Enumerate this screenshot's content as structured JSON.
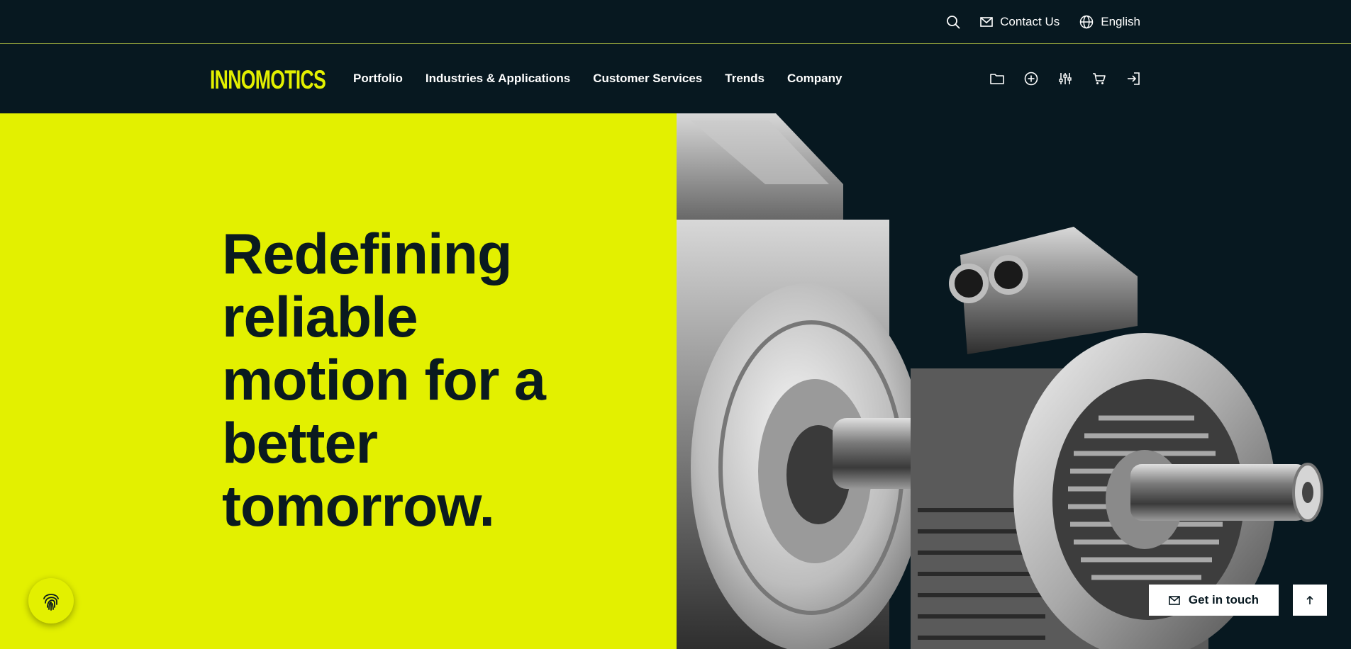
{
  "colors": {
    "brand_accent": "#e3f000",
    "background_dark": "#071820",
    "headline_text": "#0a1a1f",
    "nav_text": "#ffffff"
  },
  "utility_bar": {
    "search_icon": "search-icon",
    "contact_label": "Contact Us",
    "contact_icon": "mail-icon",
    "language_label": "English",
    "language_icon": "globe-icon"
  },
  "header": {
    "logo_text": "INNOMOTICS",
    "nav": [
      {
        "label": "Portfolio"
      },
      {
        "label": "Industries & Applications"
      },
      {
        "label": "Customer Services"
      },
      {
        "label": "Trends"
      },
      {
        "label": "Company"
      }
    ],
    "icons": [
      "folder-icon",
      "plus-circle-icon",
      "sliders-icon",
      "cart-icon",
      "login-icon"
    ]
  },
  "hero": {
    "headline": "Redefining reliable motion for a better tomorrow.",
    "image_subject": "electric-motor-image"
  },
  "floating": {
    "fingerprint_icon": "fingerprint-icon",
    "cta_label": "Get in touch",
    "cta_icon": "mail-icon",
    "scroll_top_icon": "arrow-up-icon"
  }
}
